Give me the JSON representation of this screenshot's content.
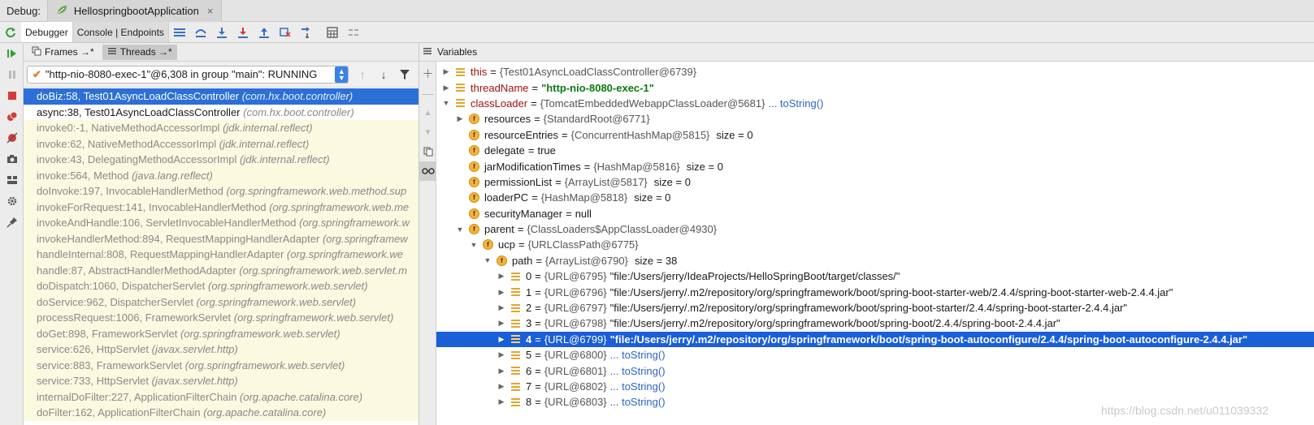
{
  "titlebar": {
    "label": "Debug:",
    "run_config": "HellospringbootApplication",
    "close": "×"
  },
  "toolbar": {
    "debugger_tab": "Debugger",
    "console_tab": "Console | Endpoints"
  },
  "frames_panel": {
    "frames_tab": "Frames →*",
    "threads_tab": "Threads →*",
    "thread_selector": "\"http-nio-8080-exec-1\"@6,308 in group \"main\": RUNNING",
    "frames": [
      {
        "method": "doBiz:58, Test01AsyncLoadClassController",
        "pkg": "(com.hx.boot.controller)",
        "state": "selected"
      },
      {
        "method": "async:38, Test01AsyncLoadClassController",
        "pkg": "(com.hx.boot.controller)",
        "state": "normal"
      },
      {
        "method": "invoke0:-1, NativeMethodAccessorImpl",
        "pkg": "(jdk.internal.reflect)",
        "state": "lib"
      },
      {
        "method": "invoke:62, NativeMethodAccessorImpl",
        "pkg": "(jdk.internal.reflect)",
        "state": "lib"
      },
      {
        "method": "invoke:43, DelegatingMethodAccessorImpl",
        "pkg": "(jdk.internal.reflect)",
        "state": "lib"
      },
      {
        "method": "invoke:564, Method",
        "pkg": "(java.lang.reflect)",
        "state": "lib"
      },
      {
        "method": "doInvoke:197, InvocableHandlerMethod",
        "pkg": "(org.springframework.web.method.sup",
        "state": "lib"
      },
      {
        "method": "invokeForRequest:141, InvocableHandlerMethod",
        "pkg": "(org.springframework.web.me",
        "state": "lib"
      },
      {
        "method": "invokeAndHandle:106, ServletInvocableHandlerMethod",
        "pkg": "(org.springframework.w",
        "state": "lib"
      },
      {
        "method": "invokeHandlerMethod:894, RequestMappingHandlerAdapter",
        "pkg": "(org.springframew",
        "state": "lib"
      },
      {
        "method": "handleInternal:808, RequestMappingHandlerAdapter",
        "pkg": "(org.springframework.we",
        "state": "lib"
      },
      {
        "method": "handle:87, AbstractHandlerMethodAdapter",
        "pkg": "(org.springframework.web.servlet.m",
        "state": "lib"
      },
      {
        "method": "doDispatch:1060, DispatcherServlet",
        "pkg": "(org.springframework.web.servlet)",
        "state": "lib"
      },
      {
        "method": "doService:962, DispatcherServlet",
        "pkg": "(org.springframework.web.servlet)",
        "state": "lib"
      },
      {
        "method": "processRequest:1006, FrameworkServlet",
        "pkg": "(org.springframework.web.servlet)",
        "state": "lib"
      },
      {
        "method": "doGet:898, FrameworkServlet",
        "pkg": "(org.springframework.web.servlet)",
        "state": "lib"
      },
      {
        "method": "service:626, HttpServlet",
        "pkg": "(javax.servlet.http)",
        "state": "lib"
      },
      {
        "method": "service:883, FrameworkServlet",
        "pkg": "(org.springframework.web.servlet)",
        "state": "lib"
      },
      {
        "method": "service:733, HttpServlet",
        "pkg": "(javax.servlet.http)",
        "state": "lib"
      },
      {
        "method": "internalDoFilter:227, ApplicationFilterChain",
        "pkg": "(org.apache.catalina.core)",
        "state": "lib"
      },
      {
        "method": "doFilter:162, ApplicationFilterChain",
        "pkg": "(org.apache.catalina.core)",
        "state": "lib"
      }
    ]
  },
  "variables_panel": {
    "header": "Variables",
    "vars": [
      {
        "indent": 0,
        "arrow": "right",
        "icon": "list",
        "name": "this",
        "eq": "=",
        "type": "{Test01AsyncLoadClassController@6739}",
        "value": "",
        "extra": "",
        "link": "",
        "style": "top"
      },
      {
        "indent": 0,
        "arrow": "right",
        "icon": "list",
        "name": "threadName",
        "eq": "=",
        "type": "",
        "value": "\"http-nio-8080-exec-1\"",
        "value_kind": "str",
        "extra": "",
        "link": "",
        "style": "top"
      },
      {
        "indent": 0,
        "arrow": "down",
        "icon": "list",
        "name": "classLoader",
        "eq": "=",
        "type": "{TomcatEmbeddedWebappClassLoader@5681}",
        "value": "",
        "extra": "",
        "link": "... toString()",
        "style": "top"
      },
      {
        "indent": 1,
        "arrow": "right",
        "icon": "f",
        "name": "resources",
        "eq": "=",
        "type": "{StandardRoot@6771}",
        "value": "",
        "extra": "",
        "link": "",
        "style": "sub"
      },
      {
        "indent": 1,
        "arrow": "",
        "icon": "f",
        "name": "resourceEntries",
        "eq": "=",
        "type": "{ConcurrentHashMap@5815}",
        "value": "",
        "extra": "size = 0",
        "link": "",
        "style": "sub"
      },
      {
        "indent": 1,
        "arrow": "",
        "icon": "f",
        "name": "delegate",
        "eq": "=",
        "type": "",
        "value": "true",
        "value_kind": "lit",
        "extra": "",
        "link": "",
        "style": "sub"
      },
      {
        "indent": 1,
        "arrow": "",
        "icon": "f",
        "name": "jarModificationTimes",
        "eq": "=",
        "type": "{HashMap@5816}",
        "value": "",
        "extra": "size = 0",
        "link": "",
        "style": "sub"
      },
      {
        "indent": 1,
        "arrow": "",
        "icon": "f",
        "name": "permissionList",
        "eq": "=",
        "type": "{ArrayList@5817}",
        "value": "",
        "extra": "size = 0",
        "link": "",
        "style": "sub"
      },
      {
        "indent": 1,
        "arrow": "",
        "icon": "f",
        "name": "loaderPC",
        "eq": "=",
        "type": "{HashMap@5818}",
        "value": "",
        "extra": "size = 0",
        "link": "",
        "style": "sub"
      },
      {
        "indent": 1,
        "arrow": "",
        "icon": "f",
        "name": "securityManager",
        "eq": "=",
        "type": "",
        "value": "null",
        "value_kind": "lit",
        "extra": "",
        "link": "",
        "style": "sub"
      },
      {
        "indent": 1,
        "arrow": "down",
        "icon": "f",
        "name": "parent",
        "eq": "=",
        "type": "{ClassLoaders$AppClassLoader@4930}",
        "value": "",
        "extra": "",
        "link": "",
        "style": "sub"
      },
      {
        "indent": 2,
        "arrow": "down",
        "icon": "f",
        "name": "ucp",
        "eq": "=",
        "type": "{URLClassPath@6775}",
        "value": "",
        "extra": "",
        "link": "",
        "style": "sub"
      },
      {
        "indent": 3,
        "arrow": "down",
        "icon": "f",
        "name": "path",
        "eq": "=",
        "type": "{ArrayList@6790}",
        "value": "",
        "extra": "size = 38",
        "link": "",
        "style": "sub"
      },
      {
        "indent": 4,
        "arrow": "right",
        "icon": "list",
        "name": "0",
        "eq": "=",
        "type": "{URL@6795}",
        "value": "\"file:/Users/jerry/IdeaProjects/HelloSpringBoot/target/classes/\"",
        "value_kind": "lit",
        "extra": "",
        "link": "",
        "style": "sub"
      },
      {
        "indent": 4,
        "arrow": "right",
        "icon": "list",
        "name": "1",
        "eq": "=",
        "type": "{URL@6796}",
        "value": "\"file:/Users/jerry/.m2/repository/org/springframework/boot/spring-boot-starter-web/2.4.4/spring-boot-starter-web-2.4.4.jar\"",
        "value_kind": "lit",
        "extra": "",
        "link": "",
        "style": "sub"
      },
      {
        "indent": 4,
        "arrow": "right",
        "icon": "list",
        "name": "2",
        "eq": "=",
        "type": "{URL@6797}",
        "value": "\"file:/Users/jerry/.m2/repository/org/springframework/boot/spring-boot-starter/2.4.4/spring-boot-starter-2.4.4.jar\"",
        "value_kind": "lit",
        "extra": "",
        "link": "",
        "style": "sub"
      },
      {
        "indent": 4,
        "arrow": "right",
        "icon": "list",
        "name": "3",
        "eq": "=",
        "type": "{URL@6798}",
        "value": "\"file:/Users/jerry/.m2/repository/org/springframework/boot/spring-boot/2.4.4/spring-boot-2.4.4.jar\"",
        "value_kind": "lit",
        "extra": "",
        "link": "",
        "style": "sub"
      },
      {
        "indent": 4,
        "arrow": "right",
        "icon": "list",
        "name": "4",
        "eq": "=",
        "type": "{URL@6799}",
        "value": "\"file:/Users/jerry/.m2/repository/org/springframework/boot/spring-boot-autoconfigure/2.4.4/spring-boot-autoconfigure-2.4.4.jar\"",
        "value_kind": "lit",
        "extra": "",
        "link": "",
        "style": "selected"
      },
      {
        "indent": 4,
        "arrow": "right",
        "icon": "list",
        "name": "5",
        "eq": "=",
        "type": "{URL@6800}",
        "value": "",
        "extra": "",
        "link": "... toString()",
        "style": "sub"
      },
      {
        "indent": 4,
        "arrow": "right",
        "icon": "list",
        "name": "6",
        "eq": "=",
        "type": "{URL@6801}",
        "value": "",
        "extra": "",
        "link": "... toString()",
        "style": "sub"
      },
      {
        "indent": 4,
        "arrow": "right",
        "icon": "list",
        "name": "7",
        "eq": "=",
        "type": "{URL@6802}",
        "value": "",
        "extra": "",
        "link": "... toString()",
        "style": "sub"
      },
      {
        "indent": 4,
        "arrow": "right",
        "icon": "list",
        "name": "8",
        "eq": "=",
        "type": "{URL@6803}",
        "value": "",
        "extra": "",
        "link": "... toString()",
        "style": "sub"
      }
    ]
  },
  "watermark": "https://blog.csdn.net/u011039332"
}
